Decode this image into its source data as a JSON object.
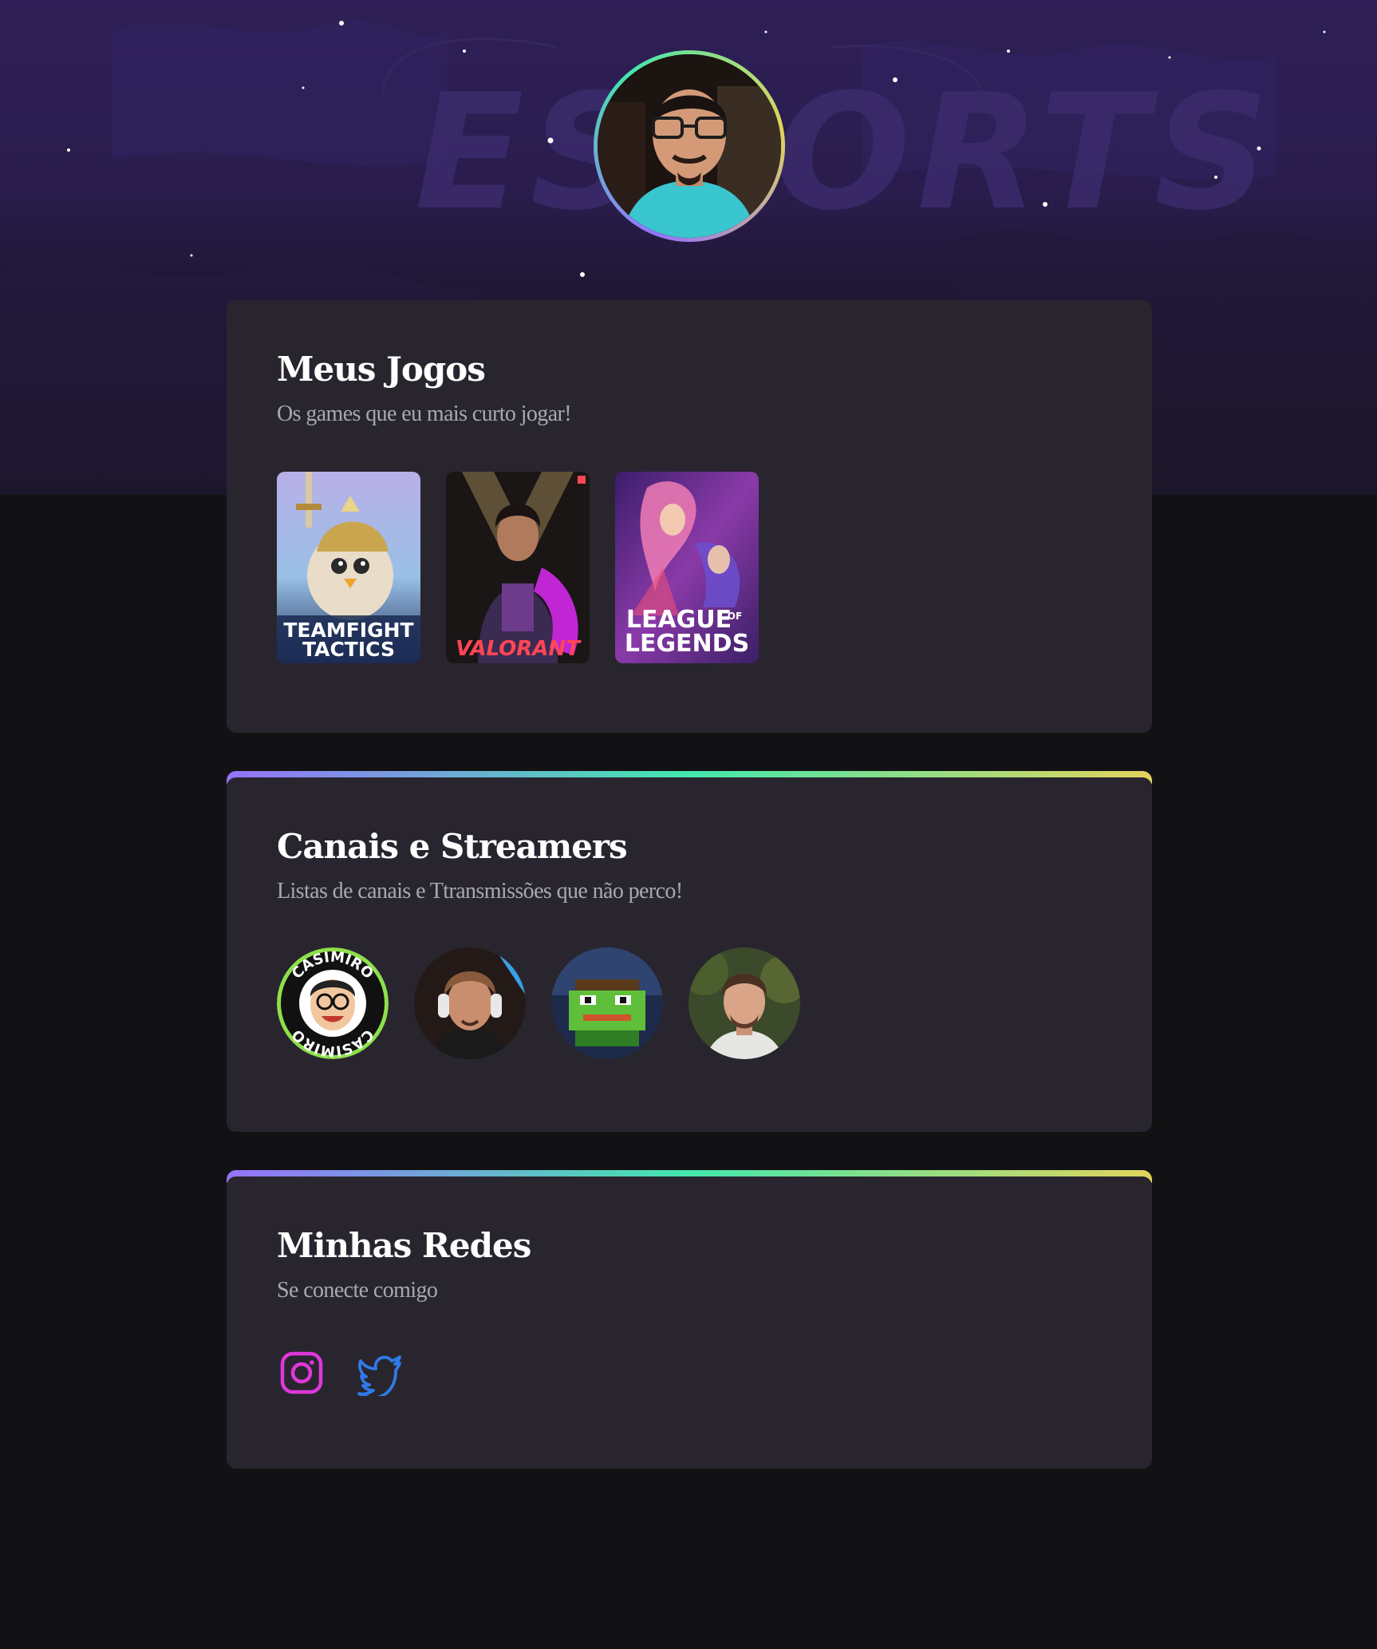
{
  "profile": {
    "avatar_icon": "profile-avatar-icon",
    "watermark": "ESPORTS"
  },
  "sections": {
    "games": {
      "title": "Meus Jogos",
      "subtitle": "Os games que eu mais curto jogar!",
      "items": [
        {
          "name": "TEAMFIGHT TACTICS",
          "line1": "TEAMFIGHT",
          "line2": "TACTICS",
          "color": "#1b2a52"
        },
        {
          "name": "VALORANT",
          "line1": "VALORANT",
          "color": "#ff4655"
        },
        {
          "name": "LEAGUE OF LEGENDS",
          "line1": "LEAGUE",
          "of": "OF",
          "line2": "LEGENDS",
          "color": "#5a2a88"
        }
      ]
    },
    "channels": {
      "title": "Canais e Streamers",
      "subtitle": "Listas de canais e Ttransmissões que não perco!",
      "items": [
        {
          "name": "casimiro-logo",
          "text": "CASIMIRO"
        },
        {
          "name": "streamer-headset"
        },
        {
          "name": "streamer-frog"
        },
        {
          "name": "streamer-portrait"
        }
      ]
    },
    "social": {
      "title": "Minhas Redes",
      "subtitle": "Se conecte comigo",
      "items": [
        {
          "name": "instagram-icon",
          "color": "#e037d9"
        },
        {
          "name": "twitter-icon",
          "color": "#2f7be8"
        }
      ]
    }
  },
  "colors": {
    "background": "#121214",
    "card": "#29252f",
    "gradient": [
      "#9572fc",
      "#43e7ad",
      "#e2d45c"
    ],
    "subtitle": "#a8a8b3"
  }
}
